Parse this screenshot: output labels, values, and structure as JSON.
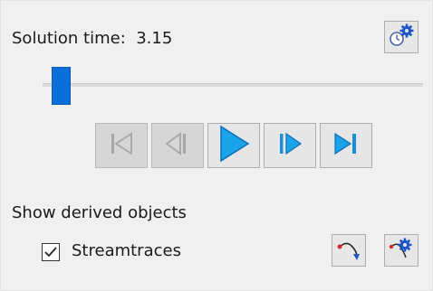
{
  "solution_time": {
    "label": "Solution time:",
    "value": "3.15"
  },
  "slider": {
    "position_fraction": 0.03
  },
  "playback": {
    "buttons": [
      {
        "name": "first-frame",
        "enabled": false
      },
      {
        "name": "previous-frame",
        "enabled": false
      },
      {
        "name": "play",
        "enabled": true
      },
      {
        "name": "next-frame",
        "enabled": true
      },
      {
        "name": "last-frame",
        "enabled": true
      }
    ]
  },
  "derived_objects": {
    "heading": "Show derived objects",
    "streamtraces": {
      "label": "Streamtraces",
      "checked": true
    }
  },
  "colors": {
    "accent_blue": "#0a6fd8",
    "disabled_gray": "#a6a6a6"
  },
  "icons": [
    "clock-gear-icon",
    "first-frame-icon",
    "previous-frame-icon",
    "play-icon",
    "next-frame-icon",
    "last-frame-icon",
    "checkmark-icon",
    "streamtrace-rake-icon",
    "streamtrace-settings-icon"
  ]
}
